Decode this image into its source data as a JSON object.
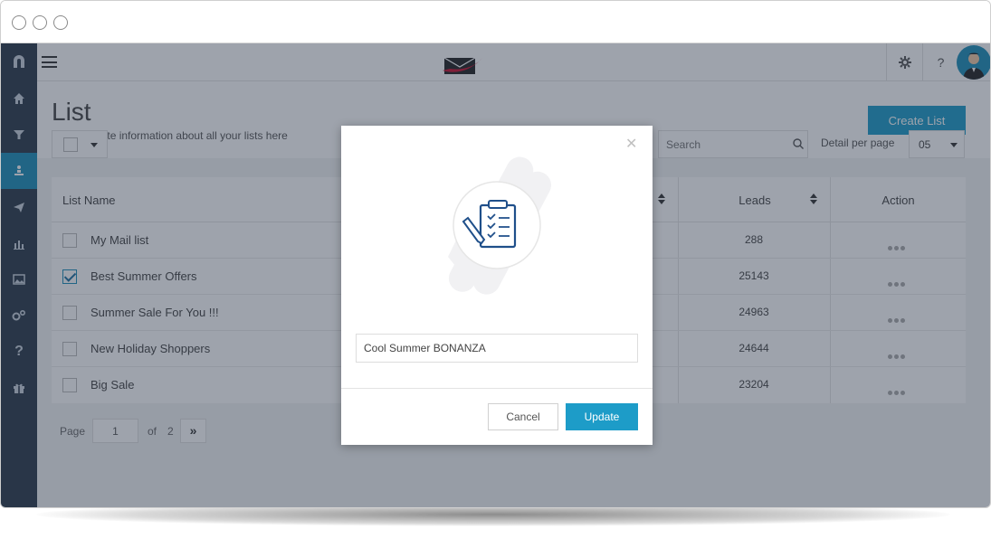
{
  "window": {
    "controls": [
      "close",
      "minimize",
      "maximize"
    ]
  },
  "sidebar": {
    "items": [
      {
        "icon": "magnet-logo-icon"
      },
      {
        "icon": "home-icon"
      },
      {
        "icon": "funnel-icon"
      },
      {
        "icon": "contacts-icon",
        "active": true
      },
      {
        "icon": "paper-plane-icon"
      },
      {
        "icon": "bar-chart-icon"
      },
      {
        "icon": "image-icon"
      },
      {
        "icon": "gears-icon"
      },
      {
        "icon": "question-icon",
        "glyph": "?"
      },
      {
        "icon": "gift-icon"
      }
    ]
  },
  "topbar": {
    "settings_icon": "gear-icon",
    "help_glyph": "?"
  },
  "header": {
    "title": "List",
    "subtitle": "Get complete information about all your lists here",
    "create_label": "Create List"
  },
  "toolbar": {
    "search_placeholder": "Search",
    "detail_label": "Detail per page",
    "detail_value": "05"
  },
  "table": {
    "columns": [
      "List Name",
      "Leads",
      "Action"
    ],
    "rows": [
      {
        "name": "My Mail list",
        "leads": "288",
        "checked": false
      },
      {
        "name": "Best Summer Offers",
        "leads": "25143",
        "checked": true
      },
      {
        "name": "Summer Sale For You !!!",
        "leads": "24963",
        "checked": false
      },
      {
        "name": "New Holiday Shoppers",
        "leads": "24644",
        "checked": false
      },
      {
        "name": "Big Sale",
        "leads": "23204",
        "checked": false
      }
    ]
  },
  "pager": {
    "label": "Page",
    "current": "1",
    "of": "of",
    "total": "2",
    "next_glyph": "»"
  },
  "modal": {
    "close_glyph": "✕",
    "input_value": "Cool Summer BONANZA",
    "cancel_label": "Cancel",
    "update_label": "Update"
  },
  "colors": {
    "accent": "#1d9cc8",
    "sidebar": "#2b3a4a"
  }
}
